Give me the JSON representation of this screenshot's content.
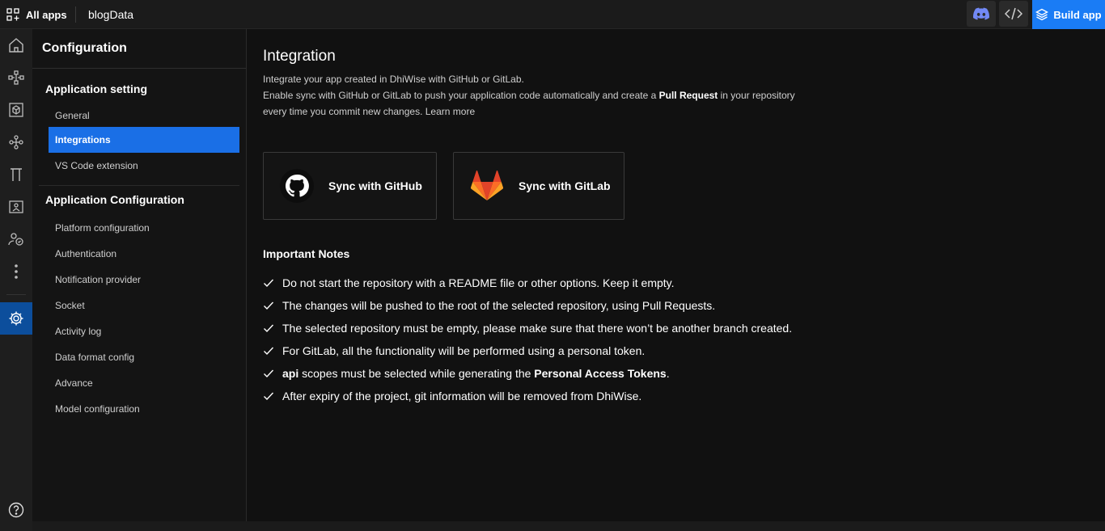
{
  "topbar": {
    "all_apps_label": "All apps",
    "app_name": "blogData",
    "build_label": "Build app",
    "discord_icon": "discord-icon",
    "code_icon": "code-icon"
  },
  "rail": {
    "items": [
      "home-icon",
      "tree-icon",
      "box-icon",
      "flow-icon",
      "pi-icon",
      "image-card-icon",
      "users-icon",
      "more-vertical-icon",
      "settings-icon",
      "help-icon"
    ],
    "active": "settings-icon"
  },
  "config": {
    "title": "Configuration",
    "sections": [
      {
        "title": "Application setting",
        "items": [
          "General",
          "Integrations",
          "VS Code extension"
        ]
      },
      {
        "title": "Application Configuration",
        "items": [
          "Platform configuration",
          "Authentication",
          "Notification provider",
          "Socket",
          "Activity log",
          "Data format config",
          "Advance",
          "Model configuration"
        ]
      }
    ],
    "active_item": "Integrations"
  },
  "main": {
    "title": "Integration",
    "desc_line1": "Integrate your app created in DhiWise with GitHub or GitLab.",
    "desc_line2_pre": "Enable sync with GitHub or GitLab to push your application code automatically and create a ",
    "desc_line2_bold": "Pull Request",
    "desc_line2_post": " in your repository",
    "desc_line3_pre": "every time you commit new changes. ",
    "desc_line3_link": "Learn more",
    "sync_github": "Sync with GitHub",
    "sync_gitlab": "Sync with GitLab",
    "notes_title": "Important Notes",
    "notes": {
      "n1": "Do not start the repository with a README file or other options. Keep it empty.",
      "n2": "The changes will be pushed to the root of the selected repository, using Pull Requests.",
      "n3": "The selected repository must be empty, please make sure that there won’t be another branch created.",
      "n4": "For GitLab, all the functionality will be performed using a personal token.",
      "n5_bold1": "api",
      "n5_mid": " scopes must be selected while generating the ",
      "n5_bold2": "Personal Access Tokens",
      "n5_end": ".",
      "n6": "After expiry of the project, git information will be removed from DhiWise."
    }
  },
  "colors": {
    "accent": "#1a7cf5",
    "active_nav": "#1a6fe6",
    "rail_active": "#0c4e9c",
    "gitlab_orange": "#fc6d26"
  }
}
